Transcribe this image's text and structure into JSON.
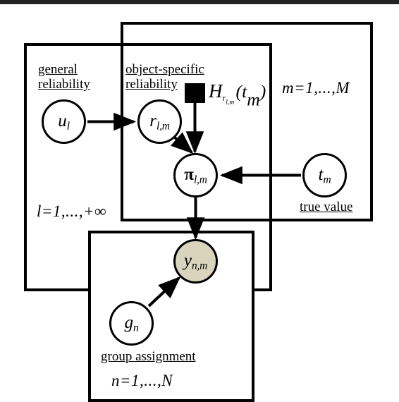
{
  "figure": {
    "type": "probabilistic-graphical-model",
    "title": "",
    "background_color": "#ffffff",
    "line_color": "#000000",
    "observed_node_color": "#dbd4bd",
    "latent_node_color": "#ffffff",
    "top_bar_color": "#232323"
  },
  "plates": [
    {
      "id": "plate-m",
      "index_label": "m=1,...,M",
      "caption": ""
    },
    {
      "id": "plate-l",
      "index_label": "l=1,...,+∞",
      "caption": ""
    },
    {
      "id": "plate-lm",
      "index_label": "",
      "caption": ""
    },
    {
      "id": "plate-n",
      "index_label": "n=1,...,N",
      "caption": "group assignment"
    }
  ],
  "nodes": [
    {
      "id": "u",
      "label": "u",
      "subscript": "l",
      "observed": false,
      "caption": "general reliability"
    },
    {
      "id": "r",
      "label": "r",
      "subscript": "l,m",
      "observed": false,
      "caption": "object-specific reliability"
    },
    {
      "id": "pi",
      "label": "π",
      "subscript": "l,m",
      "observed": false,
      "caption": ""
    },
    {
      "id": "t",
      "label": "t",
      "subscript": "m",
      "observed": false,
      "caption": "true value"
    },
    {
      "id": "y",
      "label": "y",
      "subscript": "n,m",
      "observed": true,
      "caption": ""
    },
    {
      "id": "g",
      "label": "g",
      "subscript": "n",
      "observed": false,
      "caption": "group assignment"
    }
  ],
  "factor": {
    "id": "H-factor",
    "shape": "filled-square",
    "function_name": "H",
    "function_subscript": "r",
    "function_subscript_indices": "l,m",
    "function_argument": "t",
    "function_argument_subscript": "m",
    "full_text": "H r_l,m ( t_m )"
  },
  "captions": {
    "general_reliability_line1": "general",
    "general_reliability_line2": "reliability",
    "object_specific_line1": "object-specific",
    "object_specific_line2": "reliability",
    "true_value": "true value",
    "group_assignment": "group assignment"
  },
  "indices": {
    "m": "m=1,...,M",
    "l": "l=1,...,+∞",
    "n": "n=1,...,N"
  },
  "edges": [
    {
      "from": "u",
      "to": "r",
      "style": "solid-arrow"
    },
    {
      "from": "r",
      "to": "pi",
      "style": "solid-arrow"
    },
    {
      "from": "H-factor",
      "to": "pi",
      "style": "solid-arrow"
    },
    {
      "from": "t",
      "to": "pi",
      "style": "solid-arrow"
    },
    {
      "from": "pi",
      "to": "y",
      "style": "solid-arrow"
    },
    {
      "from": "g",
      "to": "y",
      "style": "solid-arrow"
    }
  ]
}
